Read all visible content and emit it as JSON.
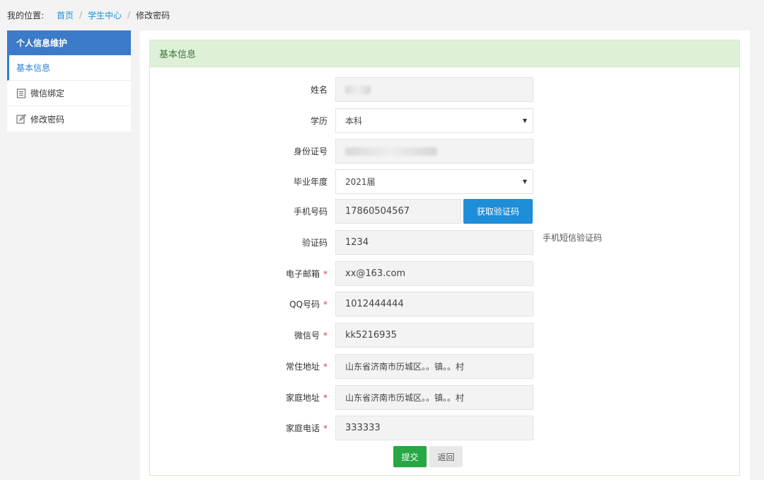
{
  "breadcrumb": {
    "label": "我的位置:",
    "items": [
      "首页",
      "学生中心"
    ],
    "current": "修改密码"
  },
  "sidebar": {
    "header": "个人信息维护",
    "items": [
      {
        "label": "基本信息",
        "icon": "none"
      },
      {
        "label": "微信绑定",
        "icon": "document-icon"
      },
      {
        "label": "修改密码",
        "icon": "edit-icon"
      }
    ]
  },
  "panel": {
    "title": "基本信息"
  },
  "form": {
    "name": {
      "label": "姓名",
      "value": "张*"
    },
    "education": {
      "label": "学历",
      "value": "本科"
    },
    "id_number": {
      "label": "身份证号",
      "value": "**************15622"
    },
    "grad_year": {
      "label": "毕业年度",
      "value": "2021届"
    },
    "phone": {
      "label": "手机号码",
      "value": "17860504567",
      "button": "获取验证码"
    },
    "code": {
      "label": "验证码",
      "value": "1234",
      "hint": "手机短信验证码"
    },
    "email": {
      "label": "电子邮箱",
      "value": "xx@163.com"
    },
    "qq": {
      "label": "QQ号码",
      "value": "1012444444"
    },
    "wechat": {
      "label": "微信号",
      "value": "kk5216935"
    },
    "address": {
      "label": "常住地址",
      "value": "山东省济南市历城区。。镇。。村"
    },
    "home_address": {
      "label": "家庭地址",
      "value": "山东省济南市历城区。。镇。。村"
    },
    "home_phone": {
      "label": "家庭电话",
      "value": "333333"
    },
    "required_mark": "*"
  },
  "actions": {
    "submit": "提交",
    "back": "返回"
  },
  "colors": {
    "accent": "#1e8ed8",
    "sidebar_header": "#3b7bc8",
    "panel_heading_bg": "#dff0d8",
    "submit": "#28a745"
  }
}
